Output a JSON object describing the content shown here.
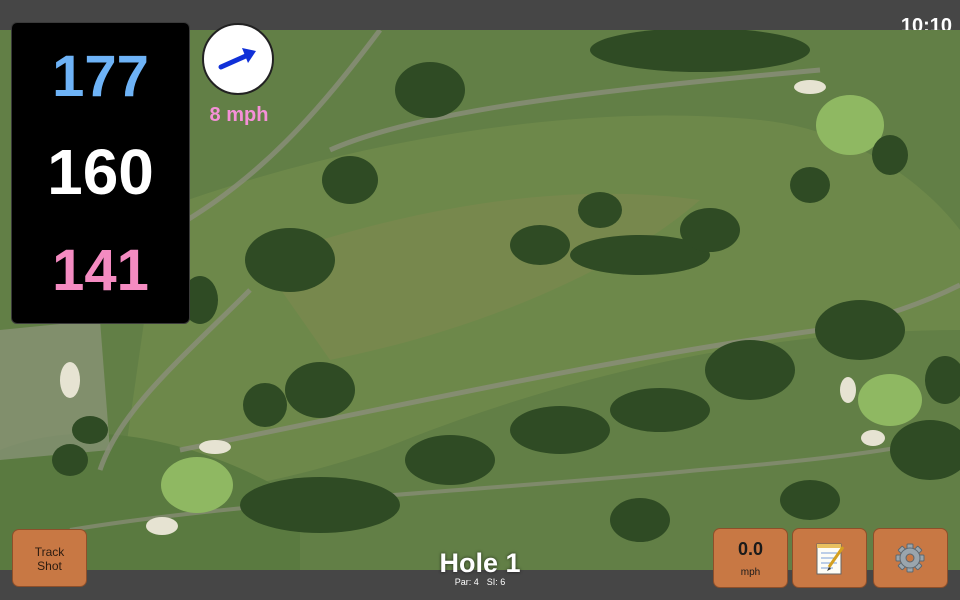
{
  "status_bar": {
    "time": "10:10"
  },
  "distances": {
    "back": "177",
    "middle": "160",
    "front": "141"
  },
  "wind": {
    "speed_label": "8 mph",
    "direction_icon": "arrow-icon"
  },
  "hole": {
    "title": "Hole 1",
    "par_label": "Par: 4",
    "si_label": "SI: 6"
  },
  "buttons": {
    "track_shot_line1": "Track",
    "track_shot_line2": "Shot",
    "speed_value": "0.0",
    "speed_unit": "mph",
    "notes_icon": "notepad-icon",
    "settings_icon": "gear-icon"
  },
  "colors": {
    "back_distance": "#6eb3f7",
    "middle_distance": "#ffffff",
    "front_distance": "#f48bc1",
    "wind_text": "#f590d8",
    "button": "#c87844",
    "bar": "#464646"
  }
}
